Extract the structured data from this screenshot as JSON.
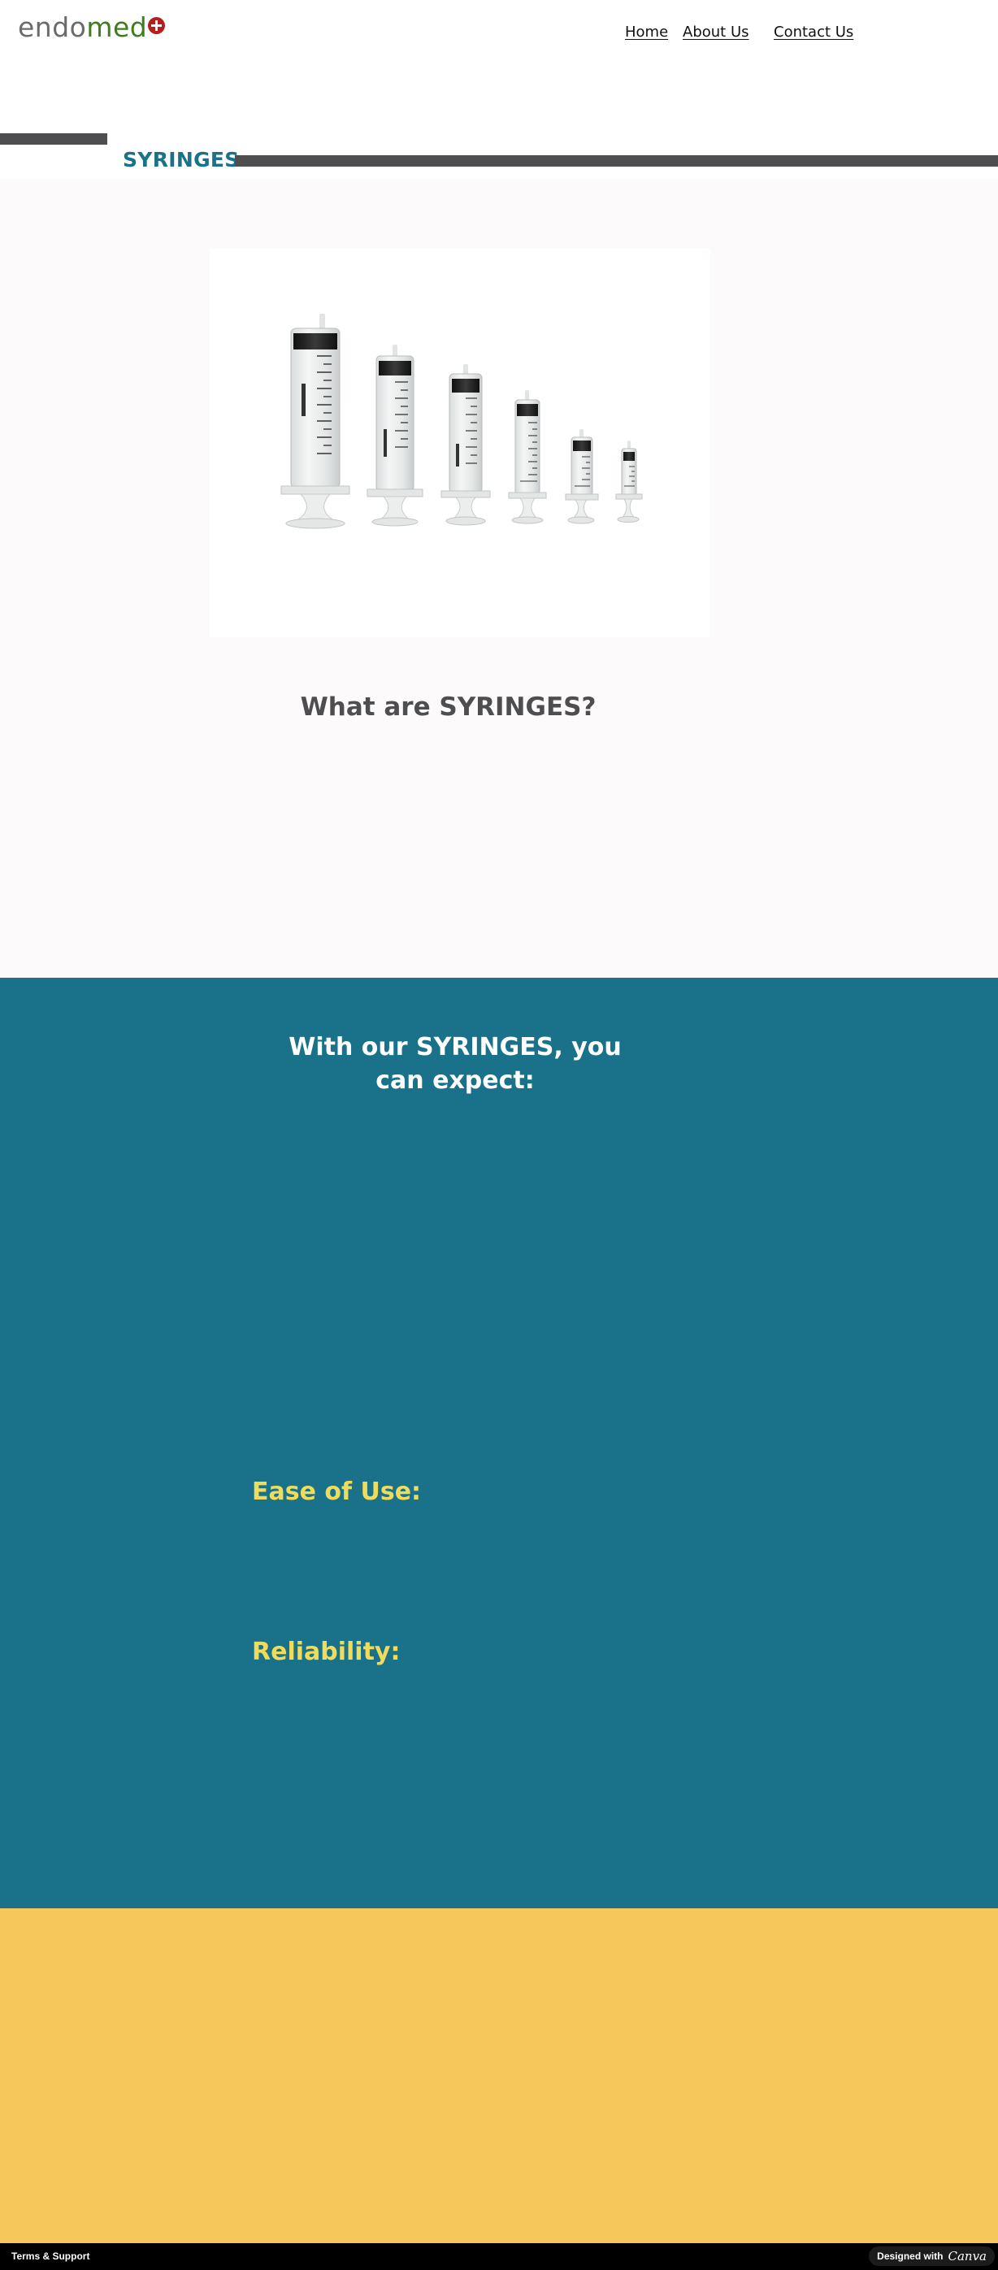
{
  "header": {
    "logo": {
      "part1": "endo",
      "part2": "med",
      "icon": "plus-cross-icon"
    },
    "nav": [
      {
        "label": "Home"
      },
      {
        "label": "About Us"
      },
      {
        "label": "Contact Us"
      }
    ],
    "page_title": "SYRINGES"
  },
  "intro": {
    "image": "syringes-product-photo",
    "heading": "What are SYRINGES?"
  },
  "features": {
    "heading": "With our SYRINGES, you can expect:",
    "items": [
      {
        "title": "Ease of Use:"
      },
      {
        "title": "Reliability:"
      }
    ]
  },
  "footer": {
    "terms": "Terms & Support",
    "designed_with": "Designed with",
    "brand": "Canva"
  },
  "colors": {
    "brand_teal": "#19728a",
    "title_teal": "#1a7288",
    "accent_yellow": "#f0dc5a",
    "section_yellow": "#f6c85c",
    "dark_gray": "#4e4e50",
    "logo_green": "#3f7d1e",
    "logo_red": "#b61f1f"
  }
}
